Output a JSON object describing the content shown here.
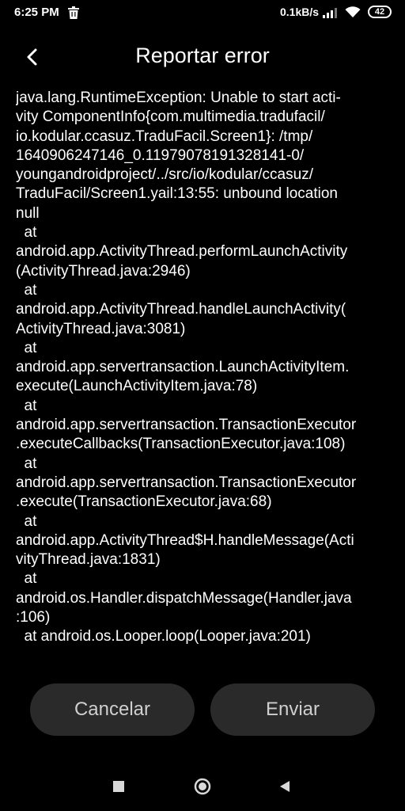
{
  "status_bar": {
    "time": "6:25 PM",
    "trash_icon": "trash-icon",
    "network_speed": "0.1kB/s",
    "signal_icon": "signal-icon",
    "wifi_icon": "wifi-icon",
    "battery_level": "42"
  },
  "header": {
    "back_icon": "chevron-left-icon",
    "title": "Reportar error"
  },
  "error_report": {
    "lines": [
      "java.lang.RuntimeException: Unable to start acti-",
      "vity ComponentInfo{com.multimedia.tradufacil/",
      "io.kodular.ccasuz.TraduFacil.Screen1}: /tmp/",
      "1640906247146_0.11979078191328141-0/",
      "youngandroidproject/../src/io/kodular/ccasuz/",
      "TraduFacil/Screen1.yail:13:55: unbound location",
      "null",
      "  at",
      "android.app.ActivityThread.performLaunchActivity",
      "(ActivityThread.java:2946)",
      "  at",
      "android.app.ActivityThread.handleLaunchActivity(",
      "ActivityThread.java:3081)",
      "  at",
      "android.app.servertransaction.LaunchActivityItem.",
      "execute(LaunchActivityItem.java:78)",
      "  at",
      "android.app.servertransaction.TransactionExecutor",
      ".executeCallbacks(TransactionExecutor.java:108)",
      "  at",
      "android.app.servertransaction.TransactionExecutor",
      ".execute(TransactionExecutor.java:68)",
      "  at",
      "android.app.ActivityThread$H.handleMessage(Acti",
      "vityThread.java:1831)",
      "  at",
      "android.os.Handler.dispatchMessage(Handler.java",
      ":106)",
      "  at android.os.Looper.loop(Looper.java:201)"
    ]
  },
  "actions": {
    "cancel_label": "Cancelar",
    "send_label": "Enviar"
  },
  "nav_bar": {
    "recents_icon": "square-icon",
    "home_icon": "circle-icon",
    "back_icon": "triangle-back-icon"
  },
  "colors": {
    "background": "#000000",
    "button_bg": "#2a2a2a",
    "button_text": "#cfcfcf",
    "text": "#ffffff"
  }
}
